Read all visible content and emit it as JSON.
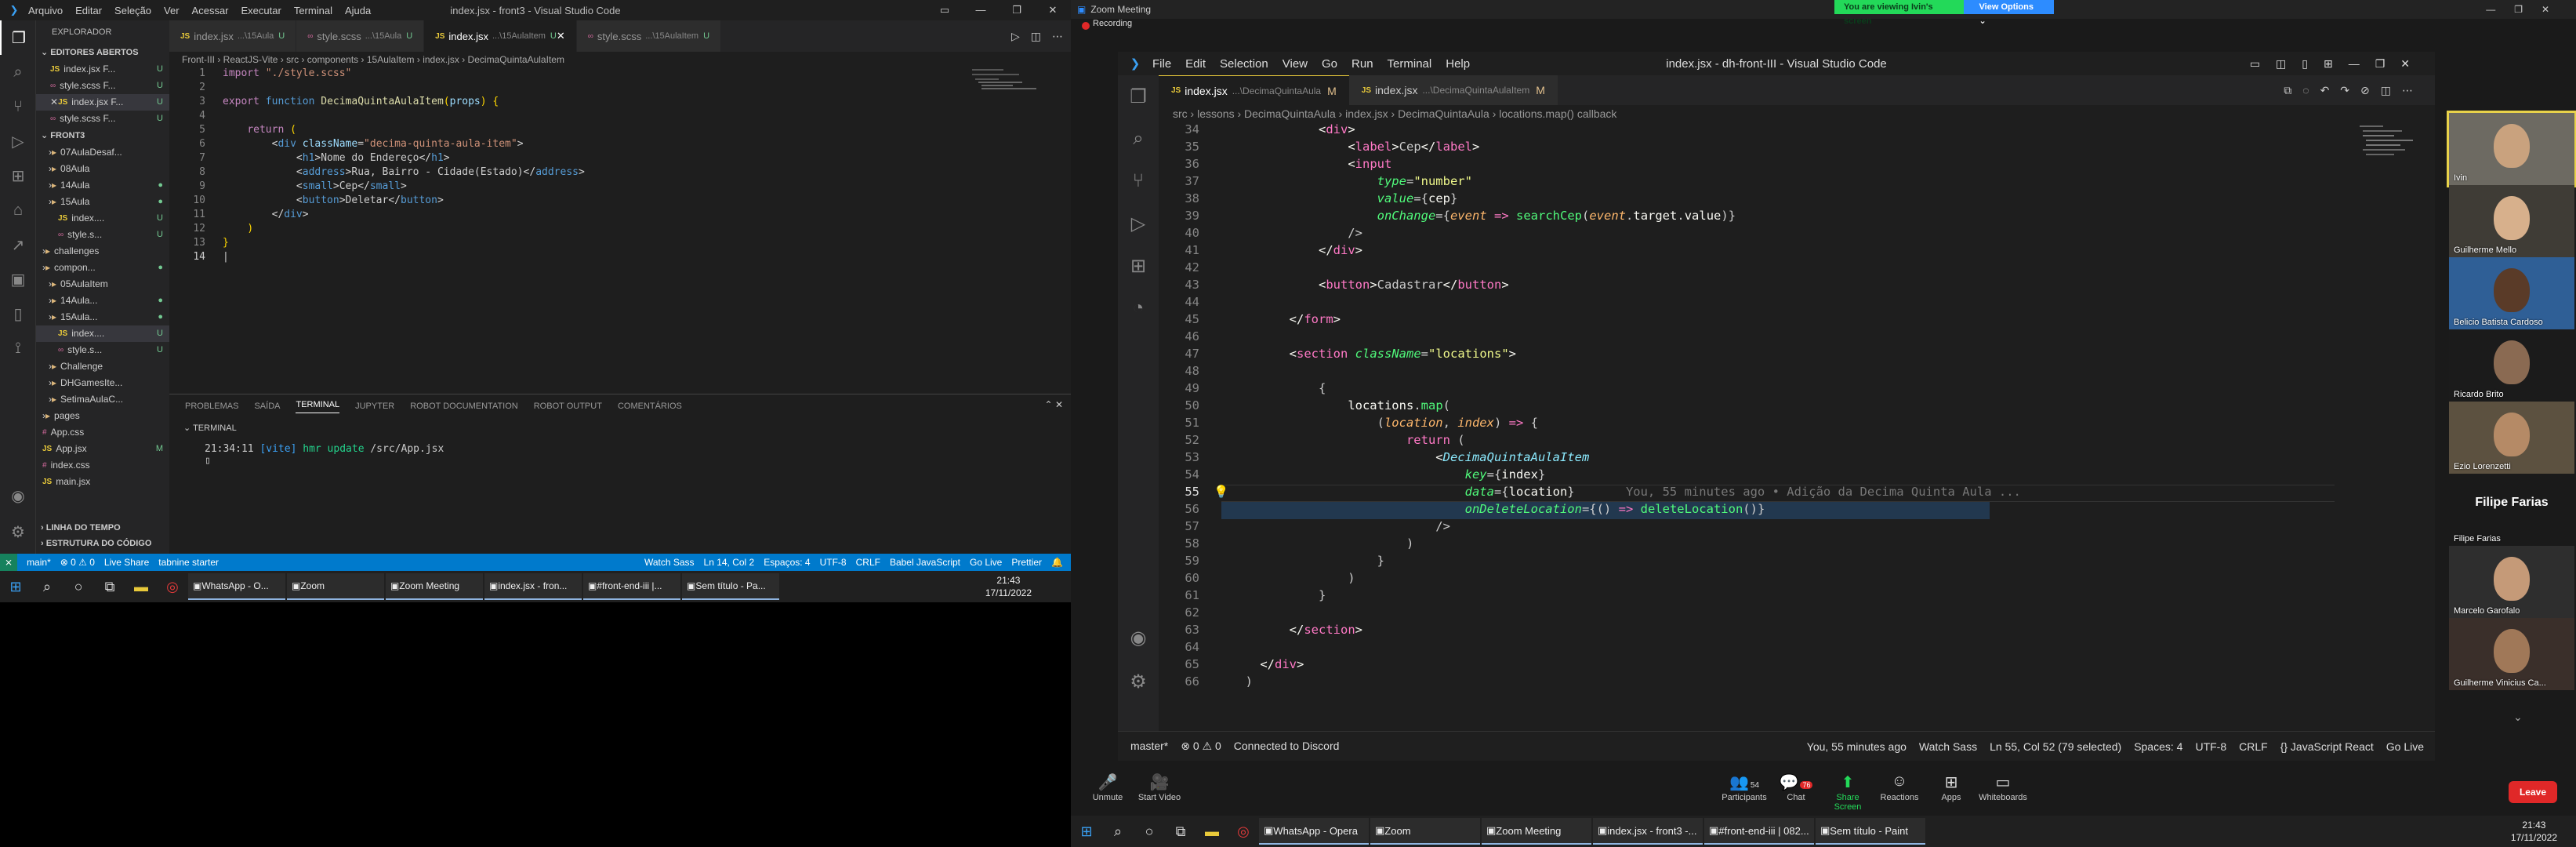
{
  "left": {
    "title": "index.jsx - front3 - Visual Studio Code",
    "menu": [
      "Arquivo",
      "Editar",
      "Seleção",
      "Ver",
      "Acessar",
      "Executar",
      "Terminal",
      "Ajuda"
    ],
    "sidebar_header": "EXPLORADOR",
    "open_editors": "EDITORES ABERTOS",
    "open_files": [
      {
        "name": "index.jsx F...",
        "badge": "U",
        "type": "js"
      },
      {
        "name": "style.scss F...",
        "badge": "U",
        "type": "scss"
      },
      {
        "name": "index.jsx F...",
        "badge": "U",
        "type": "js"
      },
      {
        "name": "style.scss F...",
        "badge": "U",
        "type": "scss"
      }
    ],
    "project": "FRONT3",
    "tree": [
      {
        "name": "07AulaDesaf...",
        "kind": "folder",
        "badge": ""
      },
      {
        "name": "08Aula",
        "kind": "folder",
        "badge": ""
      },
      {
        "name": "14Aula",
        "kind": "folder",
        "badge": "●"
      },
      {
        "name": "15Aula",
        "kind": "folder",
        "badge": "●"
      },
      {
        "name": "index....",
        "kind": "js",
        "badge": "U"
      },
      {
        "name": "style.s...",
        "kind": "scss",
        "badge": "U"
      },
      {
        "name": "challenges",
        "kind": "folder",
        "badge": ""
      },
      {
        "name": "compon...",
        "kind": "folder",
        "badge": "●"
      },
      {
        "name": "05AulaItem",
        "kind": "folder",
        "badge": ""
      },
      {
        "name": "14Aula...",
        "kind": "folder",
        "badge": "●"
      },
      {
        "name": "15Aula...",
        "kind": "folder",
        "badge": "●"
      },
      {
        "name": "index....",
        "kind": "js",
        "badge": "U"
      },
      {
        "name": "style.s...",
        "kind": "scss",
        "badge": "U"
      },
      {
        "name": "Challenge",
        "kind": "folder",
        "badge": ""
      },
      {
        "name": "DHGamesIte...",
        "kind": "folder",
        "badge": ""
      },
      {
        "name": "SetimaAulaC...",
        "kind": "folder",
        "badge": ""
      },
      {
        "name": "pages",
        "kind": "folder",
        "badge": ""
      },
      {
        "name": "App.css",
        "kind": "css",
        "badge": ""
      },
      {
        "name": "App.jsx",
        "kind": "js",
        "badge": "M"
      },
      {
        "name": "index.css",
        "kind": "css",
        "badge": ""
      },
      {
        "name": "main.jsx",
        "kind": "js",
        "badge": ""
      }
    ],
    "timeline": "LINHA DO TEMPO",
    "outline": "ESTRUTURA DO CÓDIGO",
    "tabs": [
      {
        "label": "index.jsx",
        "sub": "...\\15Aula",
        "badge": "U"
      },
      {
        "label": "style.scss",
        "sub": "...\\15Aula",
        "badge": "U"
      },
      {
        "label": "index.jsx",
        "sub": "...\\15AulaItem",
        "badge": "U",
        "active": true
      },
      {
        "label": "style.scss",
        "sub": "...\\15AulaItem",
        "badge": "U"
      }
    ],
    "breadcrumb": "Front-III  ›  ReactJS-Vite  ›  src  ›  components  ›  15AulaItem  ›  index.jsx  ›  DecimaQuintaAulaItem",
    "panel_tabs": [
      "PROBLEMAS",
      "SAÍDA",
      "TERMINAL",
      "JUPYTER",
      "ROBOT DOCUMENTATION",
      "ROBOT OUTPUT",
      "COMENTÁRIOS"
    ],
    "terminal_label": "TERMINAL",
    "terminal_time": "21:34:11",
    "terminal_vite": "[vite]",
    "terminal_hmr": "hmr update",
    "terminal_path": "/src/App.jsx",
    "status": [
      "main*",
      "⊗ 0 ⚠ 0",
      "Live Share",
      "tabnine starter"
    ],
    "status_right": [
      "Watch Sass",
      "Ln 14, Col 2",
      "Espaços: 4",
      "UTF-8",
      "CRLF",
      "Babel JavaScript",
      "Go Live",
      "Prettier"
    ],
    "taskbar": [
      "WhatsApp - O...",
      "Zoom",
      "Zoom Meeting",
      "index.jsx - fron...",
      "#front-end-iii |...",
      "Sem título - Pa..."
    ],
    "clock_time": "21:43",
    "clock_date": "17/11/2022"
  },
  "zoom": {
    "title": "Zoom Meeting",
    "recording": "Recording",
    "viewing": "You are viewing Ivin's screen",
    "view_options": "View Options",
    "shared": {
      "title": "index.jsx - dh-front-III - Visual Studio Code",
      "menu": [
        "File",
        "Edit",
        "Selection",
        "View",
        "Go",
        "Run",
        "Terminal",
        "Help"
      ],
      "tabs": [
        {
          "label": "index.jsx",
          "sub": "...\\DecimaQuintaAula",
          "badge": "M",
          "active": true
        },
        {
          "label": "index.jsx",
          "sub": "...\\DecimaQuintaAulaItem",
          "badge": "M"
        }
      ],
      "breadcrumb": "src  ›  lessons  ›  DecimaQuintaAula  ›  index.jsx  ›  DecimaQuintaAula  ›  locations.map() callback",
      "blame": "You, 55 minutes ago • Adição da Decima Quinta Aula ...",
      "status_left": [
        "master*",
        "⊗ 0 ⚠ 0",
        "Connected to Discord"
      ],
      "status_right": [
        "You, 55 minutes ago",
        "Watch Sass",
        "Ln 55, Col 52 (79 selected)",
        "Spaces: 4",
        "UTF-8",
        "CRLF",
        "{} JavaScript React",
        "Go Live"
      ]
    },
    "controls": [
      "Unmute",
      "Start Video",
      "Participants",
      "Chat",
      "Share Screen",
      "Reactions",
      "Apps",
      "Whiteboards"
    ],
    "participants_count": "54",
    "chat_badge": "76",
    "leave": "Leave",
    "gallery": [
      {
        "name": "Ivin",
        "highlight": true
      },
      {
        "name": "Guilherme Mello"
      },
      {
        "name": "Belicio Batista Cardoso"
      },
      {
        "name": "Ricardo Brito"
      },
      {
        "name": "Ezio Lorenzetti"
      },
      {
        "name": "Filipe Farias",
        "big": "Filipe Farias",
        "placeholder": true
      },
      {
        "name": "Marcelo Garofalo"
      },
      {
        "name": "Guilherme Vinicius Ca..."
      }
    ],
    "taskbar": [
      "WhatsApp - Opera",
      "Zoom",
      "Zoom Meeting",
      "index.jsx - front3 -...",
      "#front-end-iii | 082...",
      "Sem título - Paint"
    ],
    "clock_time": "21:43",
    "clock_date": "17/11/2022"
  },
  "colors": {
    "vscode_blue": "#007acc",
    "zoom_green": "#23d959",
    "zoom_blue": "#2d8cff",
    "leave_red": "#e02828"
  }
}
